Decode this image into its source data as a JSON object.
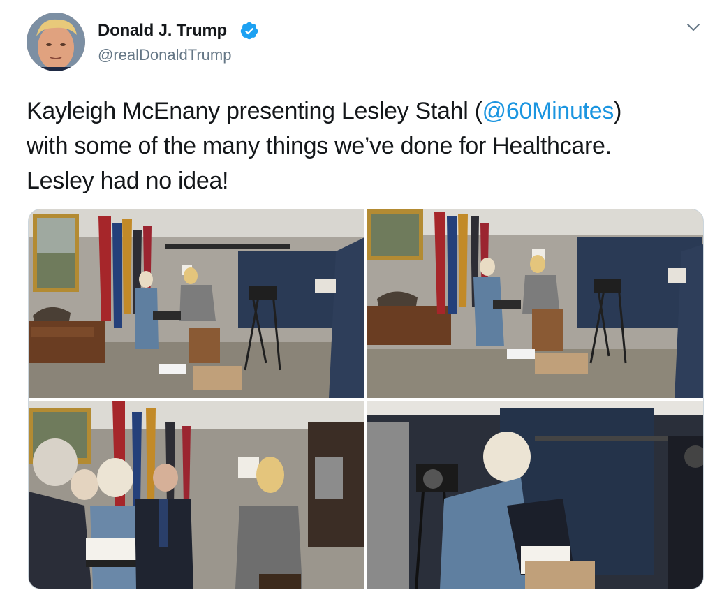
{
  "tweet": {
    "author": {
      "display_name": "Donald J. Trump",
      "handle": "@realDonaldTrump",
      "verified": true
    },
    "text": {
      "line1_before": "Kayleigh McEnany presenting Lesley Stahl (",
      "mention": "@60Minutes",
      "line1_after": ")",
      "line2": "with some of the many things we’ve done for Healthcare.",
      "line3": "Lesley had no idea!"
    },
    "media": {
      "count": 4
    }
  },
  "colors": {
    "text": "#14171a",
    "secondary": "#657786",
    "link": "#1b95e0",
    "verified": "#1da1f2",
    "border": "#ccd6dd"
  },
  "icons": {
    "verified": "verified-badge-icon",
    "menu": "chevron-down-icon"
  }
}
